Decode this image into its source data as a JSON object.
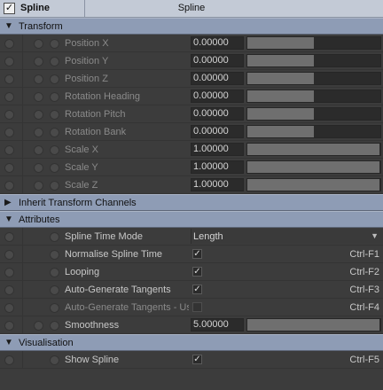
{
  "header": {
    "name": "Spline",
    "title": "Spline",
    "check": "✓"
  },
  "sections": {
    "transform": "Transform",
    "inherit": "Inherit Transform Channels",
    "attributes": "Attributes",
    "visualisation": "Visualisation"
  },
  "transform_rows": [
    {
      "label": "Position X",
      "value": "0.00000",
      "fill": 0.5
    },
    {
      "label": "Position Y",
      "value": "0.00000",
      "fill": 0.5
    },
    {
      "label": "Position Z",
      "value": "0.00000",
      "fill": 0.5
    },
    {
      "label": "Rotation Heading",
      "value": "0.00000",
      "fill": 0.5
    },
    {
      "label": "Rotation Pitch",
      "value": "0.00000",
      "fill": 0.5
    },
    {
      "label": "Rotation Bank",
      "value": "0.00000",
      "fill": 0.5
    },
    {
      "label": "Scale X",
      "value": "1.00000",
      "fill": 0.99
    },
    {
      "label": "Scale Y",
      "value": "1.00000",
      "fill": 0.99
    },
    {
      "label": "Scale Z",
      "value": "1.00000",
      "fill": 0.99
    }
  ],
  "attributes": {
    "time_mode": {
      "label": "Spline Time Mode",
      "value": "Length"
    },
    "normalise": {
      "label": "Normalise Spline Time",
      "check": "✓",
      "shortcut": "Ctrl-F1"
    },
    "looping": {
      "label": "Looping",
      "check": "✓",
      "shortcut": "Ctrl-F2"
    },
    "auto_tangents": {
      "label": "Auto-Generate Tangents",
      "check": "✓",
      "shortcut": "Ctrl-F3"
    },
    "auto_tangents_use": {
      "label": "Auto-Generate Tangents - Use",
      "check": "",
      "shortcut": "Ctrl-F4"
    },
    "smoothness": {
      "label": "Smoothness",
      "value": "5.00000",
      "fill": 0.99
    }
  },
  "visualisation": {
    "show_spline": {
      "label": "Show Spline",
      "check": "✓",
      "shortcut": "Ctrl-F5"
    }
  },
  "icons": {
    "help": "question-mark-icon",
    "anim": "keyframe-circle-icon",
    "expanded": "▼",
    "collapsed": "▶",
    "dropdown": "▼"
  }
}
